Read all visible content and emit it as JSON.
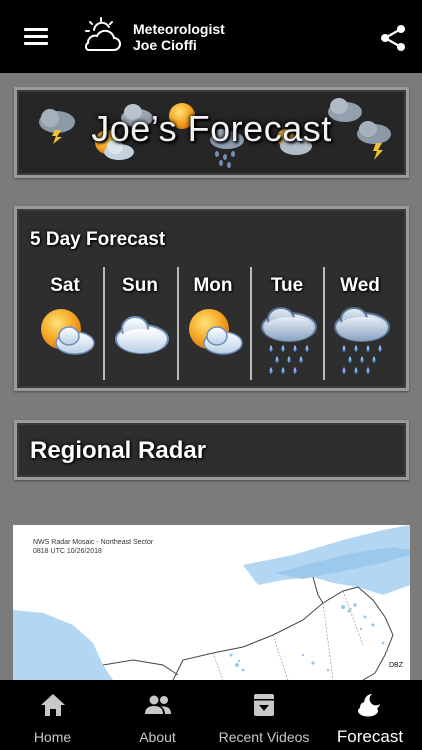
{
  "app": {
    "title_line1": "Meteorologist",
    "title_line2": "Joe Cioffi"
  },
  "icons": {
    "menu": "menu-icon",
    "logo": "partly-cloudy-logo-icon",
    "share": "share-icon"
  },
  "banner": {
    "title": "Joe’s Forecast"
  },
  "forecast": {
    "heading": "5 Day Forecast",
    "days": [
      {
        "label": "Sat",
        "condition": "partly-sunny-icon"
      },
      {
        "label": "Sun",
        "condition": "cloudy-icon"
      },
      {
        "label": "Mon",
        "condition": "partly-sunny-icon"
      },
      {
        "label": "Tue",
        "condition": "rain-icon"
      },
      {
        "label": "Wed",
        "condition": "rain-icon"
      }
    ]
  },
  "radar": {
    "heading": "Regional Radar",
    "map_title_line1": "NWS Radar Mosaic - Northeast Sector",
    "map_title_line2": "0818 UTC 10/26/2018",
    "legend_unit": "DBZ"
  },
  "nav": {
    "items": [
      {
        "label": "Home",
        "icon": "home-icon",
        "active": false
      },
      {
        "label": "About",
        "icon": "people-icon",
        "active": false
      },
      {
        "label": "Recent Videos",
        "icon": "archive-icon",
        "active": false
      },
      {
        "label": "Forecast",
        "icon": "night-cloud-icon",
        "active": true
      }
    ]
  },
  "colors": {
    "background": "#7b7b7b",
    "bar": "#000000",
    "panel": "#2e2e2e",
    "panel_border": "#9a9a9a",
    "map_water": "#b3d6f2"
  }
}
